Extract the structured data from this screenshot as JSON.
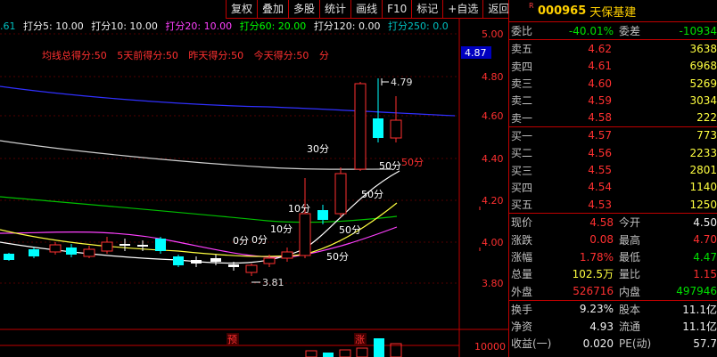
{
  "toolbar": [
    "复权",
    "叠加",
    "多股",
    "统计",
    "画线",
    "F10",
    "标记",
    "+自选",
    "返回"
  ],
  "indicators": [
    {
      "text": "打分5: 10.00",
      "color": "#f0f0f0"
    },
    {
      "text": "打分10: 10.00",
      "color": "#f0f0f0"
    },
    {
      "text": "打分20: 10.00",
      "color": "#ff40ff"
    },
    {
      "text": "打分60: 20.00",
      "color": "#00ff00"
    },
    {
      "text": "打分120: 0.00",
      "color": "#f0f0f0"
    },
    {
      "text": "打分250: 0.0",
      "color": "#00c0c0"
    }
  ],
  "indicator_prefix": ".61",
  "scores": [
    "均线总得分:50",
    "5天前得分:50",
    "昨天得分:50",
    "今天得分:50",
    "分"
  ],
  "price_axis": [
    "5.00",
    "4.80",
    "4.60",
    "4.40",
    "4.20",
    "4.00",
    "3.80"
  ],
  "current_price_tag": "4.87",
  "volume_axis": "10000",
  "chart_labels": {
    "high": "4.79",
    "low": "3.81",
    "score_30": "30分",
    "score_50a": "50分",
    "score_50b": "50分",
    "score_50c": "50分",
    "score_50red": "50分",
    "score_10a": "10分",
    "score_10b": "10分",
    "score_0a": "0分",
    "score_0b": "0分",
    "marker_yu": "预",
    "marker_zhang": "涨"
  },
  "stock": {
    "flag": "R",
    "code": "000965",
    "name": "天保基建"
  },
  "weibi": {
    "label": "委比",
    "value": "-40.01%",
    "label2": "委差",
    "value2": "-10934"
  },
  "sells": [
    {
      "label": "卖五",
      "price": "4.62",
      "vol": "3638"
    },
    {
      "label": "卖四",
      "price": "4.61",
      "vol": "6968"
    },
    {
      "label": "卖三",
      "price": "4.60",
      "vol": "5269"
    },
    {
      "label": "卖二",
      "price": "4.59",
      "vol": "3034"
    },
    {
      "label": "卖一",
      "price": "4.58",
      "vol": "222"
    }
  ],
  "buys": [
    {
      "label": "买一",
      "price": "4.57",
      "vol": "773"
    },
    {
      "label": "买二",
      "price": "4.56",
      "vol": "2233"
    },
    {
      "label": "买三",
      "price": "4.55",
      "vol": "2801"
    },
    {
      "label": "买四",
      "price": "4.54",
      "vol": "1140"
    },
    {
      "label": "买五",
      "price": "4.53",
      "vol": "1250"
    }
  ],
  "quote": [
    {
      "l1": "现价",
      "v1": "4.58",
      "c1": "red",
      "l2": "今开",
      "v2": "4.50",
      "c2": "white"
    },
    {
      "l1": "涨跌",
      "v1": "0.08",
      "c1": "red",
      "l2": "最高",
      "v2": "4.70",
      "c2": "red"
    },
    {
      "l1": "涨幅",
      "v1": "1.78%",
      "c1": "red",
      "l2": "最低",
      "v2": "4.47",
      "c2": "green"
    },
    {
      "l1": "总量",
      "v1": "102.5万",
      "c1": "yellow",
      "l2": "量比",
      "v2": "1.15",
      "c2": "red"
    },
    {
      "l1": "外盘",
      "v1": "526716",
      "c1": "red",
      "l2": "内盘",
      "v2": "497946",
      "c2": "green"
    }
  ],
  "fundamentals": [
    {
      "l1": "换手",
      "v1": "9.23%",
      "l2": "股本",
      "v2": "11.1亿"
    },
    {
      "l1": "净资",
      "v1": "4.93",
      "l2": "流通",
      "v2": "11.1亿"
    },
    {
      "l1": "收益(一)",
      "v1": "0.020",
      "l2": "PE(动)",
      "v2": "57.7"
    }
  ],
  "colors": {
    "up": "#ff3030",
    "down": "#00ffff",
    "border": "#c00000"
  }
}
